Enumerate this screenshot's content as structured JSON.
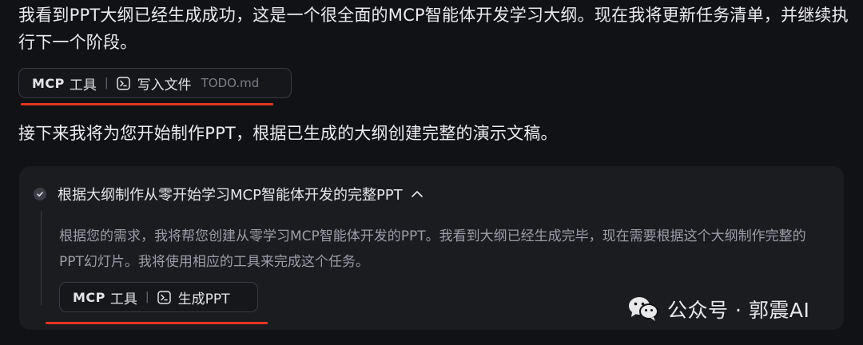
{
  "messages": {
    "intro": "我看到PPT大纲已经生成成功，这是一个很全面的MCP智能体开发学习大纲。现在我将更新任务清单，并继续执行下一个阶段。",
    "next": "接下来我将为您开始制作PPT，根据已生成的大纲创建完整的演示文稿。"
  },
  "tool_chip_1": {
    "mcp": "MCP",
    "tools_label": "工具",
    "separator": "|",
    "action": "写入文件",
    "file": "TODO.md"
  },
  "task": {
    "title": "根据大纲制作从零开始学习MCP智能体开发的完整PPT",
    "body": "根据您的需求，我将帮您创建从零学习MCP智能体开发的PPT。我看到大纲已经生成完毕，现在需要根据这个大纲制作完整的PPT幻灯片。我将使用相应的工具来完成这个任务。",
    "tool_chip": {
      "mcp": "MCP",
      "tools_label": "工具",
      "separator": "|",
      "action": "生成PPT"
    }
  },
  "watermark": {
    "text": "公众号 · 郭震AI",
    "icon": "wechat-icon"
  },
  "colors": {
    "background": "#111215",
    "card": "#1b1c20",
    "accent_underline": "#e5361f",
    "muted_text": "#9c9da6"
  }
}
